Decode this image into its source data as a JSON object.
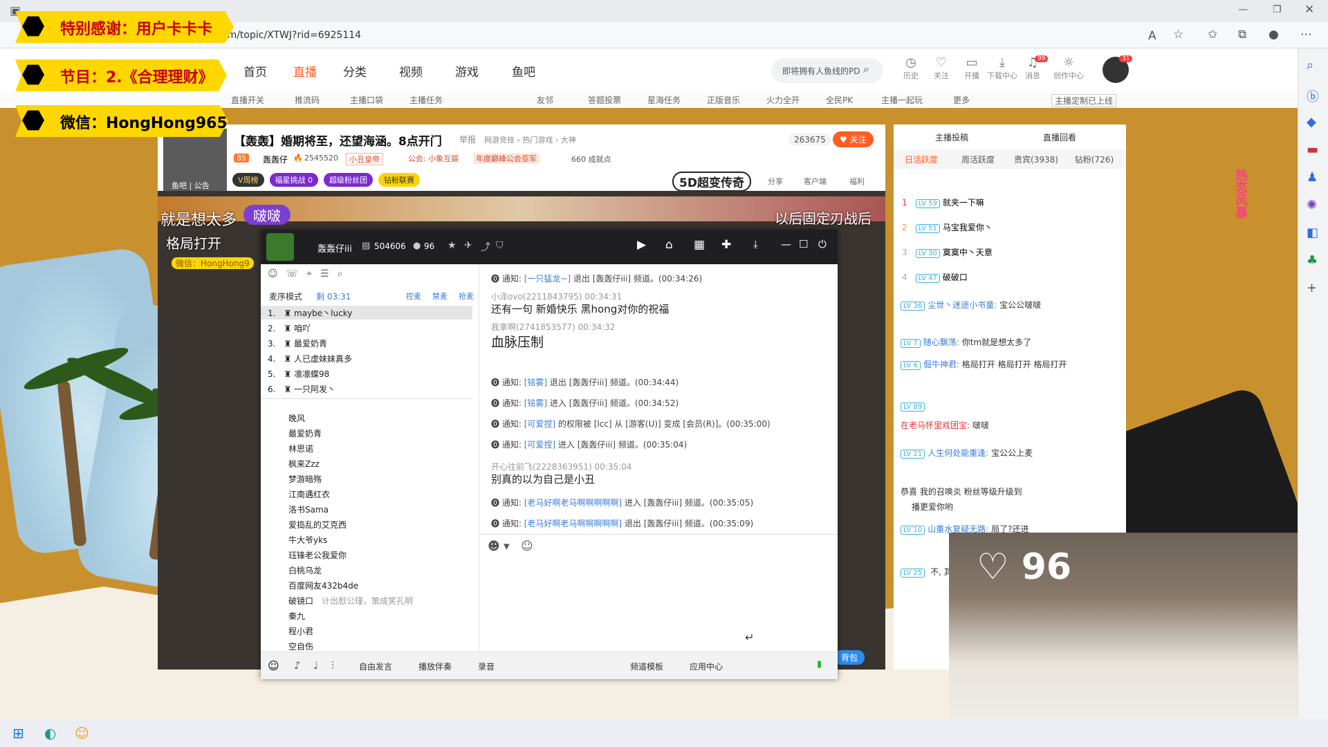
{
  "browser": {
    "url": "om/topic/XTWJ?rid=6925114"
  },
  "banners": [
    "特别感谢：用户卡卡卡",
    "节目：2.《合理理财》",
    "微信：HongHong9654"
  ],
  "nav": {
    "items": [
      "首页",
      "直播",
      "分类",
      "视频",
      "游戏",
      "鱼吧"
    ],
    "search_placeholder": "即将拥有人鱼线的PD",
    "user_icons": [
      "历史",
      "关注",
      "开播",
      "下载中心",
      "消息",
      "创作中心"
    ],
    "msg_badge": "99",
    "avatar_badge": "31"
  },
  "subnav": [
    "直播开关",
    "推流码",
    "主播口袋",
    "主播任务",
    "友邻",
    "答题投票",
    "星海任务",
    "正版音乐",
    "火力全开",
    "全民PK",
    "主播一起玩",
    "更多",
    "主播定制已上线"
  ],
  "room": {
    "title": "【轰轰】婚期将至，还望海涵。8点开门",
    "report": "举报",
    "category": "网游竞技 › 热门游戏 › 大神",
    "level": "85",
    "host": "轰轰仔",
    "hot": "2545520",
    "tag1": "小丑皇帝",
    "guild": "公会: 小象互娱",
    "tag2": "年度巅峰公会亚军",
    "achieve": "660 成就点",
    "followers": "263675",
    "follow": "关注",
    "pills": [
      "V周榜",
      "福星挑战",
      "超级粉丝团",
      "钻粉联赛"
    ],
    "fuxing_count": "0",
    "actions": [
      "分享",
      "客户端",
      "福利"
    ],
    "brand": "5D超变传奇",
    "avatar_caption": "鱼吧 | 公告"
  },
  "yy": {
    "channel_name": "轰轰仔iii",
    "channel_id": "504606",
    "online": "96",
    "mode": "麦序模式",
    "remain": "剩 03:31",
    "controls": [
      "控麦",
      "禁麦",
      "抢麦"
    ],
    "queue": [
      [
        "1.",
        "maybe丶lucky"
      ],
      [
        "2.",
        "咱吖"
      ],
      [
        "3.",
        "最爱奶青"
      ],
      [
        "4.",
        "人已虚妹妹真多"
      ],
      [
        "5.",
        "凛凛蝶98"
      ],
      [
        "6.",
        "一只阿发丶"
      ]
    ],
    "members": [
      "晚风",
      "最爱奶青",
      "林思诺",
      "枫来Zzz",
      "梦游暗殇",
      "江南遇红衣",
      "洛书Sama",
      "爱捣乱的艾克西",
      "牛大爷yks",
      "珏锋老公我爱你",
      "白桃乌龙",
      "百度网友432b4de",
      "破镜口",
      "秦九",
      "程小君",
      "空自伤"
    ],
    "member_note": "计出慰公瑾，策成笑孔明",
    "messages": [
      {
        "t": "通知: ",
        "b": "[一只猛龙~]",
        "r": " 退出 [轰轰仔iii] 频道。(00:34:26)"
      },
      {
        "user": "小泽ovo(2211843795)  00:34:31",
        "text": "还有一句  新婚快乐  黑hong对你的祝福"
      },
      {
        "user": "我拿啊(2741853577)  00:34:32",
        "text": "血脉压制"
      },
      {
        "t": "通知: ",
        "b": "[铭雾]",
        "r": " 退出 [轰轰仔iii] 频道。(00:34:44)"
      },
      {
        "t": "通知: ",
        "b": "[铭雾]",
        "r": " 进入 [轰轰仔iii] 频道。(00:34:52)"
      },
      {
        "t": "通知: ",
        "b": "[可爱捏]",
        "r": " 的权限被 [lcc] 从 [游客(U)] 变成 [会员(R)]。(00:35:00)"
      },
      {
        "t": "通知: ",
        "b": "[可爱捏]",
        "r": " 进入 [轰轰仔iii] 频道。(00:35:04)"
      },
      {
        "user": "开心往前飞(2228363951)  00:35:04",
        "text": "别真的以为自己是小丑"
      },
      {
        "t": "通知: ",
        "b": "[老马好啊老马啊啊啊啊啊]",
        "r": " 进入 [轰轰仔iii] 频道。(00:35:05)"
      },
      {
        "t": "通知: ",
        "b": "[老马好啊老马啊啊啊啊啊]",
        "r": " 退出 [轰轰仔iii] 频道。(00:35:09)"
      }
    ],
    "bottom": [
      "自由发言",
      "播放伴奏",
      "录音",
      "频道模板",
      "应用中心"
    ]
  },
  "overlay": {
    "name": "啵啵",
    "left_text": "就是想太多",
    "left_text2": "格局打开",
    "wechat": "微信：HongHong9",
    "right_text": "以后固定刃战后"
  },
  "panel": {
    "links": [
      "主播投稿",
      "直播回看"
    ],
    "tabs": [
      "日活跃度",
      "周活跃度",
      "贵宾(3938)",
      "钻粉(726)"
    ],
    "rank": [
      [
        "1",
        "59",
        "就夹一下嘛"
      ],
      [
        "2",
        "51",
        "马宝我爱你丶"
      ],
      [
        "3",
        "30",
        "寞寞中丶天意"
      ],
      [
        "4",
        "47",
        "破破口"
      ]
    ],
    "chats": [
      [
        "36",
        "尘世丶迷途小书童:",
        "宝公公啵啵"
      ],
      [
        "7",
        "随心飘荡:",
        "你tm就是想太多了"
      ],
      [
        "6",
        "倔牛神君:",
        "格局打开 格局打开 格局打开"
      ],
      [
        "89",
        "",
        "啵啵"
      ],
      [
        "21",
        "人生何处能重逢:",
        "宝公公上麦"
      ],
      [
        "10",
        "山重水复疑无路:",
        "局了?还进"
      ],
      [
        "25",
        "",
        "不, 其实在"
      ]
    ],
    "slogan": "在老马怀里戏团宝:",
    "upgrade": "恭喜 我的召唤炎 粉丝等级升级到",
    "upgrade2": "播更爱你哟",
    "hearts": "96",
    "fun": "热恋风暴",
    "backpack": "背包"
  }
}
